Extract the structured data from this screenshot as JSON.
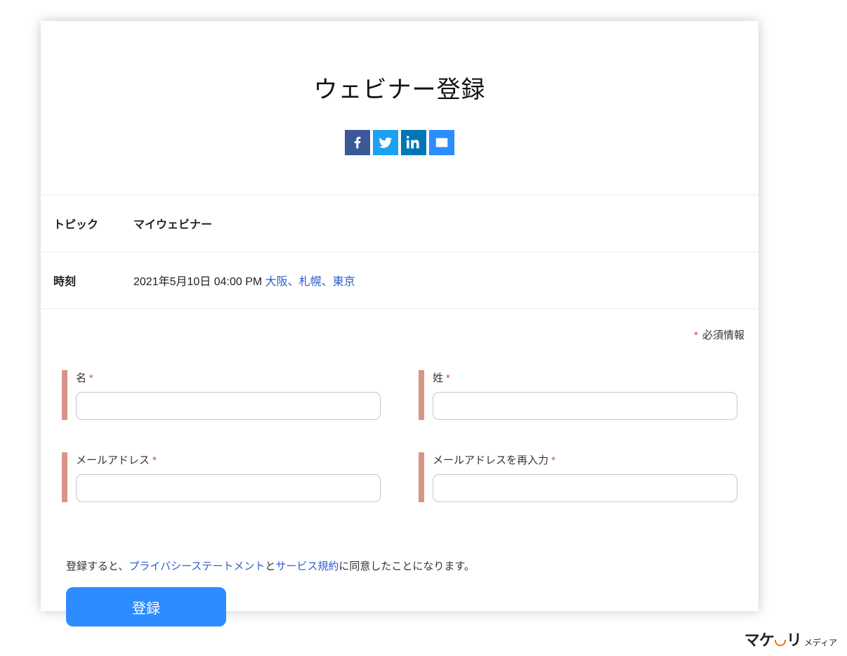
{
  "title": "ウェビナー登録",
  "info": {
    "topic_label": "トピック",
    "topic_value": "マイウェビナー",
    "time_label": "時刻",
    "time_value": "2021年5月10日 04:00 PM ",
    "timezone": "大阪、札幌、東京"
  },
  "required_note": "必須情報",
  "fields": {
    "first_name": "名",
    "last_name": "姓",
    "email": "メールアドレス",
    "email_confirm": "メールアドレスを再入力"
  },
  "agree": {
    "prefix": "登録すると、",
    "privacy": "プライバシーステートメント",
    "and": "と",
    "terms": "サービス規約",
    "suffix": "に同意したことになります。"
  },
  "submit": "登録",
  "watermark": {
    "brand": "マケフリ",
    "sub": "メディア"
  }
}
